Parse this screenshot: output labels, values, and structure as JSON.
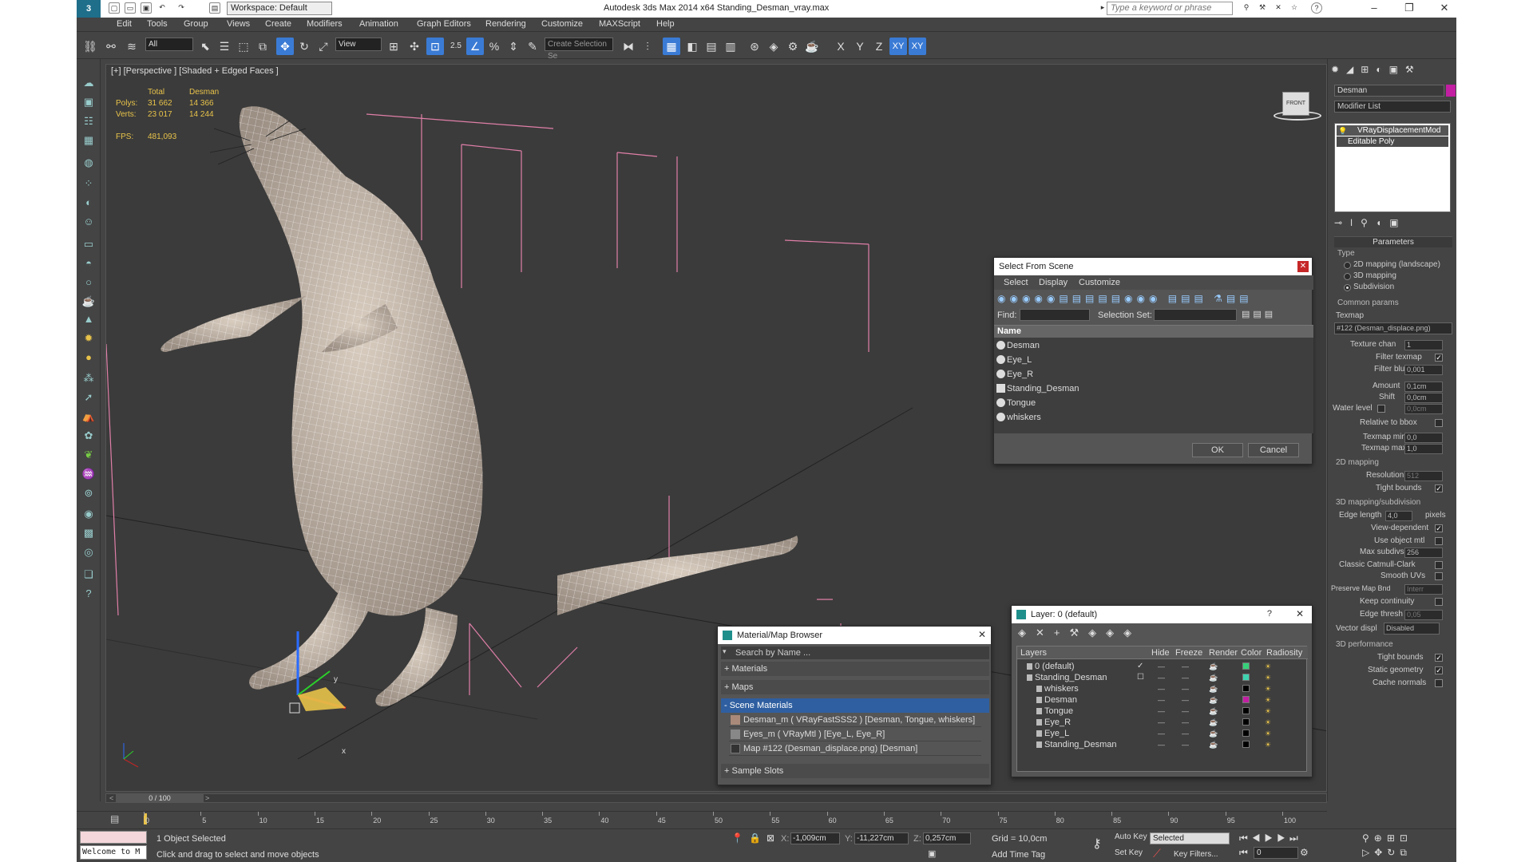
{
  "title": {
    "workspace": "Workspace: Default",
    "app_title": "Autodesk 3ds Max  2014 x64      Standing_Desman_vray.max",
    "search_placeholder": "Type a keyword or phrase"
  },
  "menu": [
    "Edit",
    "Tools",
    "Group",
    "Views",
    "Create",
    "Modifiers",
    "Animation",
    "Graph Editors",
    "Rendering",
    "Customize",
    "MAXScript",
    "Help"
  ],
  "toolbar": {
    "filter": "All",
    "ref_coord": "View",
    "snap_angle": "2.5",
    "selection_set": "Create Selection Se",
    "axis_x": "X",
    "axis_y": "Y",
    "axis_z": "Z",
    "axis_xy": "XY",
    "axis_xy2": "XY"
  },
  "viewport": {
    "label": "[+] [Perspective ] [Shaded + Edged Faces ]",
    "stats_total": "Total",
    "stats_object": "Desman",
    "polys_label": "Polys:",
    "polys_total": "31 662",
    "polys_object": "14 366",
    "verts_label": "Verts:",
    "verts_total": "23 017",
    "verts_object": "14 244",
    "fps_label": "FPS:",
    "fps_value": "481,093",
    "viewcube_label": "FRONT",
    "gizmo_x": "x",
    "gizmo_y": "y"
  },
  "select_from_scene": {
    "title": "Select From Scene",
    "menu": [
      "Select",
      "Display",
      "Customize"
    ],
    "find_label": "Find:",
    "selection_set_label": "Selection Set:",
    "column_name": "Name",
    "items": [
      "Desman",
      "Eye_L",
      "Eye_R",
      "Standing_Desman",
      "Tongue",
      "whiskers"
    ],
    "ok": "OK",
    "cancel": "Cancel"
  },
  "material_browser": {
    "title": "Material/Map Browser",
    "search": "Search by Name ...",
    "materials": "+ Materials",
    "maps": "+ Maps",
    "scene_materials": "- Scene Materials",
    "entries": [
      "Desman_m  ( VRayFastSSS2 ) [Desman, Tongue, whiskers]",
      "Eyes_m  ( VRayMtl ) [Eye_L, Eye_R]",
      "Map #122 (Desman_displace.png)  [Desman]"
    ],
    "sample_slots": "+ Sample Slots"
  },
  "layer_dialog": {
    "title": "Layer: 0 (default)",
    "help": "?",
    "columns": [
      "Layers",
      "Hide",
      "Freeze",
      "Render",
      "Color",
      "Radiosity"
    ],
    "rows": [
      {
        "name": "0 (default)",
        "indent": 1,
        "color": "#36d07a"
      },
      {
        "name": "Standing_Desman",
        "indent": 1,
        "color": "#3fd4b0"
      },
      {
        "name": "whiskers",
        "indent": 2,
        "color": "#000000"
      },
      {
        "name": "Desman",
        "indent": 2,
        "color": "#c21fa3"
      },
      {
        "name": "Tongue",
        "indent": 2,
        "color": "#000000"
      },
      {
        "name": "Eye_R",
        "indent": 2,
        "color": "#000000"
      },
      {
        "name": "Eye_L",
        "indent": 2,
        "color": "#000000"
      },
      {
        "name": "Standing_Desman",
        "indent": 2,
        "color": "#000000"
      }
    ]
  },
  "command_panel": {
    "object_name": "Desman",
    "object_color": "#c21fa3",
    "modifier_list": "Modifier List",
    "stack": [
      "VRayDisplacementMod",
      "Editable Poly"
    ],
    "parameters": "Parameters",
    "type_label": "Type",
    "type_2d": "2D mapping (landscape)",
    "type_3d": "3D mapping",
    "type_sub": "Subdivision",
    "common_params": "Common params",
    "texmap_label": "Texmap",
    "texmap_value": "#122 (Desman_displace.png)",
    "texture_chan_label": "Texture chan",
    "texture_chan": "1",
    "filter_texmap": "Filter texmap",
    "filter_blur_label": "Filter blur",
    "filter_blur": "0,001",
    "amount_label": "Amount",
    "amount": "0,1cm",
    "shift_label": "Shift",
    "shift": "0,0cm",
    "water_level_label": "Water level",
    "water_level": "0,0cm",
    "relative_bbox": "Relative to bbox",
    "texmap_min_label": "Texmap min",
    "texmap_min": "0,0",
    "texmap_max_label": "Texmap max",
    "texmap_max": "1,0",
    "mapping_2d": "2D mapping",
    "resolution_label": "Resolution",
    "resolution": "512",
    "tight_bounds": "Tight bounds",
    "mapping_3d": "3D mapping/subdivision",
    "edge_length_label": "Edge length",
    "edge_length": "4,0",
    "pixels": "pixels",
    "view_dependent": "View-dependent",
    "use_object_mtl": "Use object mtl",
    "max_subdivs_label": "Max subdivs",
    "max_subdivs": "256",
    "classic_catmull": "Classic Catmull-Clark",
    "smooth_uvs": "Smooth UVs",
    "preserve_map_bnd": "Preserve Map Bnd",
    "preserve_value": "Interr",
    "keep_continuity": "Keep continuity",
    "edge_thresh_label": "Edge thresh",
    "edge_thresh": "0,05",
    "vector_displ_label": "Vector displ",
    "vector_displ": "Disabled",
    "performance": "3D performance",
    "perf_tight_bounds": "Tight bounds",
    "static_geometry": "Static geometry",
    "cache_normals": "Cache normals"
  },
  "timeline": {
    "frame": "0 / 100",
    "ticks": [
      "0",
      "5",
      "10",
      "15",
      "20",
      "25",
      "30",
      "35",
      "40",
      "45",
      "50",
      "55",
      "60",
      "65",
      "70",
      "75",
      "80",
      "85",
      "90",
      "95",
      "100"
    ]
  },
  "status": {
    "maxscript": "Welcome to M",
    "selected": "1 Object Selected",
    "prompt": "Click and drag to select and move objects",
    "x": "-1,009cm",
    "y": "-11,227cm",
    "z": "0,257cm",
    "grid": "Grid = 10,0cm",
    "add_time_tag": "Add Time Tag",
    "auto_key": "Auto Key",
    "set_key": "Set Key",
    "key_mode": "Selected",
    "key_filters": "Key Filters...",
    "frame_field": "0"
  }
}
